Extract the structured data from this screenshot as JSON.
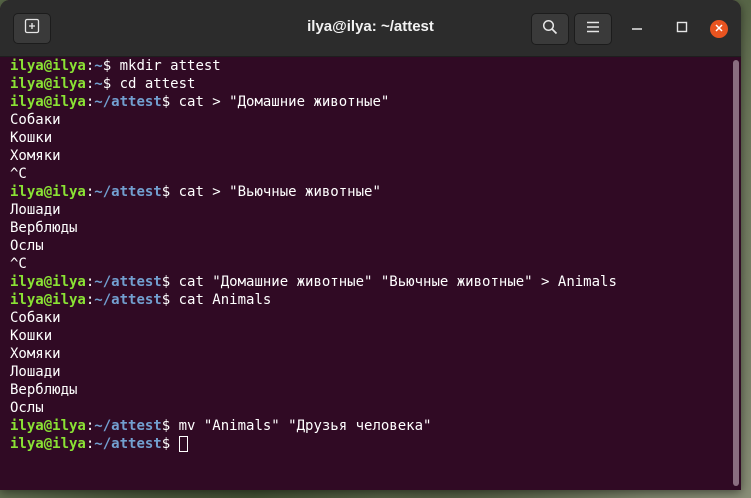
{
  "window": {
    "title": "ilya@ilya: ~/attest"
  },
  "terminal": {
    "lines": [
      {
        "user": "ilya@ilya",
        "path": "~",
        "cmd": "mkdir attest"
      },
      {
        "user": "ilya@ilya",
        "path": "~",
        "cmd": "cd attest"
      },
      {
        "user": "ilya@ilya",
        "path": "~/attest",
        "cmd": "cat > \"Домашние животные\""
      },
      {
        "text": "Собаки"
      },
      {
        "text": "Кошки"
      },
      {
        "text": "Хомяки"
      },
      {
        "text": "^C"
      },
      {
        "user": "ilya@ilya",
        "path": "~/attest",
        "cmd": "cat > \"Вьючные животные\""
      },
      {
        "text": "Лошади"
      },
      {
        "text": "Верблюды"
      },
      {
        "text": "Ослы"
      },
      {
        "text": "^C"
      },
      {
        "user": "ilya@ilya",
        "path": "~/attest",
        "cmd": "cat \"Домашние животные\" \"Вьючные животные\" > Animals"
      },
      {
        "user": "ilya@ilya",
        "path": "~/attest",
        "cmd": "cat Animals"
      },
      {
        "text": "Собаки"
      },
      {
        "text": "Кошки"
      },
      {
        "text": "Хомяки"
      },
      {
        "text": "Лошади"
      },
      {
        "text": "Верблюды"
      },
      {
        "text": "Ослы"
      },
      {
        "user": "ilya@ilya",
        "path": "~/attest",
        "cmd": "mv \"Animals\" \"Друзья человека\""
      },
      {
        "user": "ilya@ilya",
        "path": "~/attest",
        "cmd": "",
        "cursor": true
      }
    ]
  },
  "icons": {
    "new_tab": "new-tab-icon",
    "search": "search-icon",
    "menu": "hamburger-menu-icon",
    "minimize": "minimize-icon",
    "maximize": "maximize-icon",
    "close": "close-icon"
  },
  "colors": {
    "terminal_bg": "#300a24",
    "titlebar_bg": "#2c2c2c",
    "prompt_user": "#8ae234",
    "prompt_path": "#729fcf",
    "close_button": "#e95420"
  }
}
